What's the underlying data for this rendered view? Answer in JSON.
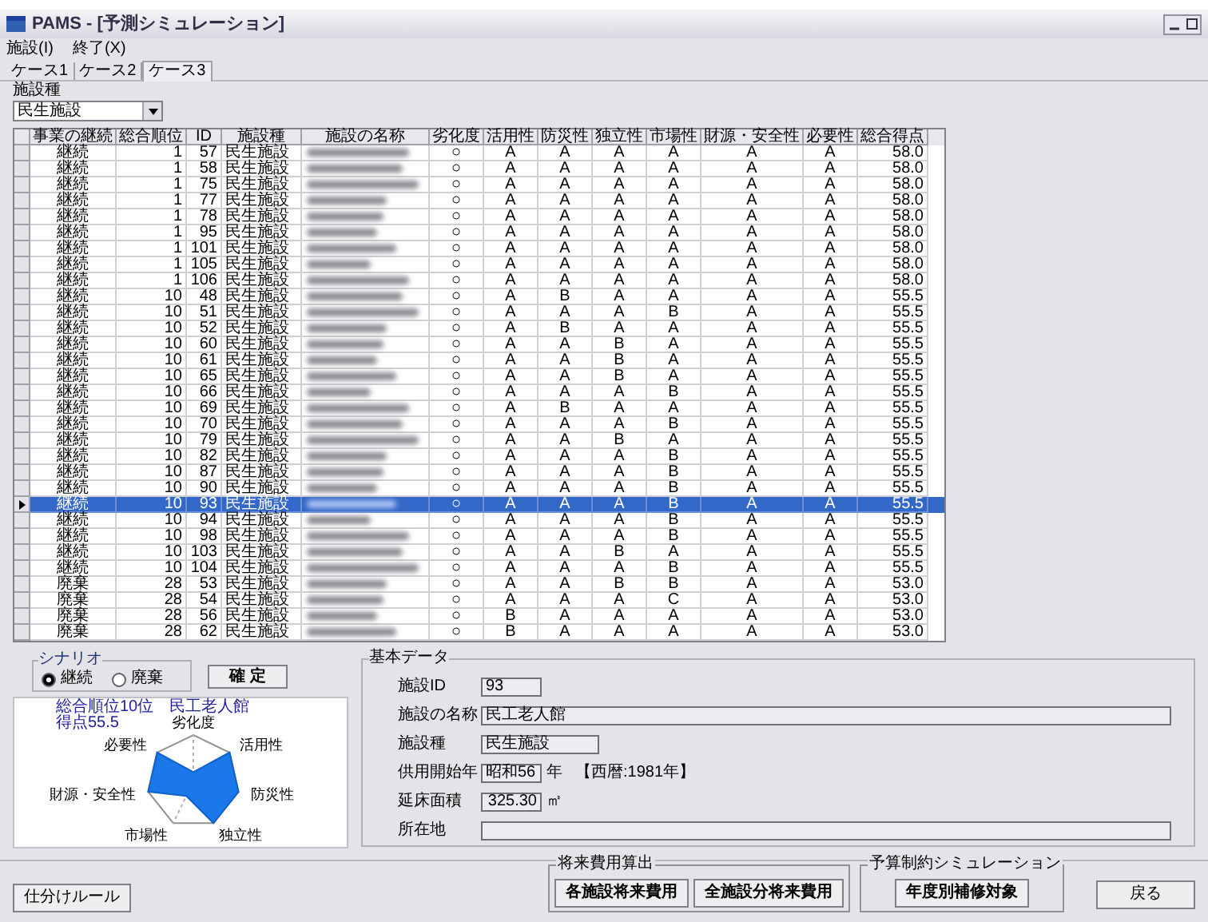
{
  "window": {
    "title": "PAMS - [予測シミュレーション]"
  },
  "menu": [
    "施設(I)",
    "終了(X)"
  ],
  "tabs": [
    {
      "label": "ケース1",
      "selected": false
    },
    {
      "label": "ケース2",
      "selected": false
    },
    {
      "label": "ケース3",
      "selected": true
    }
  ],
  "facility_type_filter": {
    "label": "施設種",
    "value": "民生施設"
  },
  "table": {
    "columns": [
      "事業の継続",
      "総合順位",
      "ID",
      "施設種",
      "施設の名称",
      "劣化度",
      "活用性",
      "防災性",
      "独立性",
      "市場性",
      "財源・安全性",
      "必要性",
      "総合得点"
    ],
    "rows": [
      {
        "scenario": "継続",
        "rank": "1",
        "id": "57",
        "type": "民生施設",
        "grades": [
          "○",
          "A",
          "A",
          "A",
          "A",
          "A",
          "A"
        ],
        "score": "58.0",
        "selected": false
      },
      {
        "scenario": "継続",
        "rank": "1",
        "id": "58",
        "type": "民生施設",
        "grades": [
          "○",
          "A",
          "A",
          "A",
          "A",
          "A",
          "A"
        ],
        "score": "58.0",
        "selected": false
      },
      {
        "scenario": "継続",
        "rank": "1",
        "id": "75",
        "type": "民生施設",
        "grades": [
          "○",
          "A",
          "A",
          "A",
          "A",
          "A",
          "A"
        ],
        "score": "58.0",
        "selected": false
      },
      {
        "scenario": "継続",
        "rank": "1",
        "id": "77",
        "type": "民生施設",
        "grades": [
          "○",
          "A",
          "A",
          "A",
          "A",
          "A",
          "A"
        ],
        "score": "58.0",
        "selected": false
      },
      {
        "scenario": "継続",
        "rank": "1",
        "id": "78",
        "type": "民生施設",
        "grades": [
          "○",
          "A",
          "A",
          "A",
          "A",
          "A",
          "A"
        ],
        "score": "58.0",
        "selected": false
      },
      {
        "scenario": "継続",
        "rank": "1",
        "id": "95",
        "type": "民生施設",
        "grades": [
          "○",
          "A",
          "A",
          "A",
          "A",
          "A",
          "A"
        ],
        "score": "58.0",
        "selected": false
      },
      {
        "scenario": "継続",
        "rank": "1",
        "id": "101",
        "type": "民生施設",
        "grades": [
          "○",
          "A",
          "A",
          "A",
          "A",
          "A",
          "A"
        ],
        "score": "58.0",
        "selected": false
      },
      {
        "scenario": "継続",
        "rank": "1",
        "id": "105",
        "type": "民生施設",
        "grades": [
          "○",
          "A",
          "A",
          "A",
          "A",
          "A",
          "A"
        ],
        "score": "58.0",
        "selected": false
      },
      {
        "scenario": "継続",
        "rank": "1",
        "id": "106",
        "type": "民生施設",
        "grades": [
          "○",
          "A",
          "A",
          "A",
          "A",
          "A",
          "A"
        ],
        "score": "58.0",
        "selected": false
      },
      {
        "scenario": "継続",
        "rank": "10",
        "id": "48",
        "type": "民生施設",
        "grades": [
          "○",
          "A",
          "B",
          "A",
          "A",
          "A",
          "A"
        ],
        "score": "55.5",
        "selected": false
      },
      {
        "scenario": "継続",
        "rank": "10",
        "id": "51",
        "type": "民生施設",
        "grades": [
          "○",
          "A",
          "A",
          "A",
          "B",
          "A",
          "A"
        ],
        "score": "55.5",
        "selected": false
      },
      {
        "scenario": "継続",
        "rank": "10",
        "id": "52",
        "type": "民生施設",
        "grades": [
          "○",
          "A",
          "B",
          "A",
          "A",
          "A",
          "A"
        ],
        "score": "55.5",
        "selected": false
      },
      {
        "scenario": "継続",
        "rank": "10",
        "id": "60",
        "type": "民生施設",
        "grades": [
          "○",
          "A",
          "A",
          "B",
          "A",
          "A",
          "A"
        ],
        "score": "55.5",
        "selected": false
      },
      {
        "scenario": "継続",
        "rank": "10",
        "id": "61",
        "type": "民生施設",
        "grades": [
          "○",
          "A",
          "A",
          "B",
          "A",
          "A",
          "A"
        ],
        "score": "55.5",
        "selected": false
      },
      {
        "scenario": "継続",
        "rank": "10",
        "id": "65",
        "type": "民生施設",
        "grades": [
          "○",
          "A",
          "A",
          "B",
          "A",
          "A",
          "A"
        ],
        "score": "55.5",
        "selected": false
      },
      {
        "scenario": "継続",
        "rank": "10",
        "id": "66",
        "type": "民生施設",
        "grades": [
          "○",
          "A",
          "A",
          "A",
          "B",
          "A",
          "A"
        ],
        "score": "55.5",
        "selected": false
      },
      {
        "scenario": "継続",
        "rank": "10",
        "id": "69",
        "type": "民生施設",
        "grades": [
          "○",
          "A",
          "B",
          "A",
          "A",
          "A",
          "A"
        ],
        "score": "55.5",
        "selected": false
      },
      {
        "scenario": "継続",
        "rank": "10",
        "id": "70",
        "type": "民生施設",
        "grades": [
          "○",
          "A",
          "A",
          "A",
          "B",
          "A",
          "A"
        ],
        "score": "55.5",
        "selected": false
      },
      {
        "scenario": "継続",
        "rank": "10",
        "id": "79",
        "type": "民生施設",
        "grades": [
          "○",
          "A",
          "A",
          "B",
          "A",
          "A",
          "A"
        ],
        "score": "55.5",
        "selected": false
      },
      {
        "scenario": "継続",
        "rank": "10",
        "id": "82",
        "type": "民生施設",
        "grades": [
          "○",
          "A",
          "A",
          "A",
          "B",
          "A",
          "A"
        ],
        "score": "55.5",
        "selected": false
      },
      {
        "scenario": "継続",
        "rank": "10",
        "id": "87",
        "type": "民生施設",
        "grades": [
          "○",
          "A",
          "A",
          "A",
          "B",
          "A",
          "A"
        ],
        "score": "55.5",
        "selected": false
      },
      {
        "scenario": "継続",
        "rank": "10",
        "id": "90",
        "type": "民生施設",
        "grades": [
          "○",
          "A",
          "A",
          "A",
          "B",
          "A",
          "A"
        ],
        "score": "55.5",
        "selected": false
      },
      {
        "scenario": "継続",
        "rank": "10",
        "id": "93",
        "type": "民生施設",
        "grades": [
          "○",
          "A",
          "A",
          "A",
          "B",
          "A",
          "A"
        ],
        "score": "55.5",
        "selected": true
      },
      {
        "scenario": "継続",
        "rank": "10",
        "id": "94",
        "type": "民生施設",
        "grades": [
          "○",
          "A",
          "A",
          "A",
          "B",
          "A",
          "A"
        ],
        "score": "55.5",
        "selected": false
      },
      {
        "scenario": "継続",
        "rank": "10",
        "id": "98",
        "type": "民生施設",
        "grades": [
          "○",
          "A",
          "A",
          "A",
          "B",
          "A",
          "A"
        ],
        "score": "55.5",
        "selected": false
      },
      {
        "scenario": "継続",
        "rank": "10",
        "id": "103",
        "type": "民生施設",
        "grades": [
          "○",
          "A",
          "A",
          "B",
          "A",
          "A",
          "A"
        ],
        "score": "55.5",
        "selected": false
      },
      {
        "scenario": "継続",
        "rank": "10",
        "id": "104",
        "type": "民生施設",
        "grades": [
          "○",
          "A",
          "A",
          "A",
          "B",
          "A",
          "A"
        ],
        "score": "55.5",
        "selected": false
      },
      {
        "scenario": "廃棄",
        "rank": "28",
        "id": "53",
        "type": "民生施設",
        "grades": [
          "○",
          "A",
          "A",
          "B",
          "B",
          "A",
          "A"
        ],
        "score": "53.0",
        "selected": false
      },
      {
        "scenario": "廃棄",
        "rank": "28",
        "id": "54",
        "type": "民生施設",
        "grades": [
          "○",
          "A",
          "A",
          "A",
          "C",
          "A",
          "A"
        ],
        "score": "53.0",
        "selected": false
      },
      {
        "scenario": "廃棄",
        "rank": "28",
        "id": "56",
        "type": "民生施設",
        "grades": [
          "○",
          "B",
          "A",
          "A",
          "A",
          "A",
          "A"
        ],
        "score": "53.0",
        "selected": false
      },
      {
        "scenario": "廃棄",
        "rank": "28",
        "id": "62",
        "type": "民生施設",
        "grades": [
          "○",
          "B",
          "A",
          "A",
          "A",
          "A",
          "A"
        ],
        "score": "53.0",
        "selected": false
      }
    ]
  },
  "scenario": {
    "label": "シナリオ",
    "options": [
      {
        "label": "継続",
        "selected": true
      },
      {
        "label": "廃棄",
        "selected": false
      }
    ]
  },
  "confirm_button": "確 定",
  "radar": {
    "title": "総合順位10位　民工老人館",
    "subtitle": "得点55.5",
    "axes": [
      "劣化度",
      "活用性",
      "防災性",
      "独立性",
      "市場性",
      "財源・安全性",
      "必要性"
    ]
  },
  "basic_data": {
    "title": "基本データ",
    "fields": [
      {
        "label": "施設ID",
        "value": "93"
      },
      {
        "label": "施設の名称",
        "value": "民工老人館"
      },
      {
        "label": "施設種",
        "value": "民生施設"
      },
      {
        "label": "供用開始年",
        "value": "昭和56",
        "unit": "年",
        "note": "【西暦:1981年】"
      },
      {
        "label": "延床面積",
        "value": "325.30",
        "unit": "㎡"
      },
      {
        "label": "所在地"
      }
    ]
  },
  "footer": {
    "rule_button": "仕分けルール",
    "groups": [
      {
        "title": "将来費用算出",
        "buttons": [
          "各施設将来費用",
          "全施設分将来費用"
        ]
      },
      {
        "title": "予算制約シミュレーション",
        "buttons": [
          "年度別補修対象"
        ]
      }
    ],
    "back_button": "戻る"
  }
}
